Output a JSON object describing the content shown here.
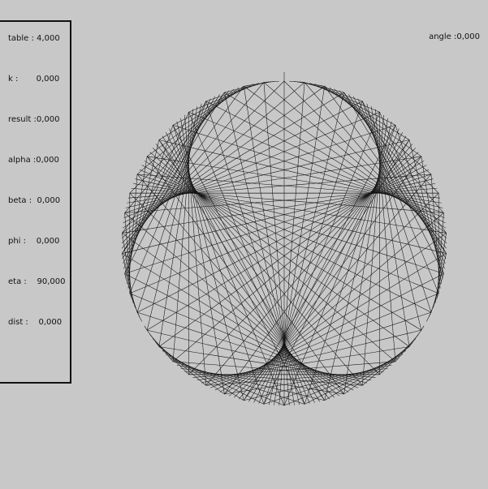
{
  "panel": {
    "table": "table : 4,000",
    "k": "k :       0,000",
    "result": "result :0,000",
    "alpha": "alpha :0,000",
    "beta": "beta :  0,000",
    "phi": "phi :    0,000",
    "eta": "eta :    90,000",
    "dist": "dist :    0,000"
  },
  "angle": "angle :0,000",
  "figure": {
    "multiplier": 4,
    "points": 200,
    "start_angle_deg": 90
  }
}
